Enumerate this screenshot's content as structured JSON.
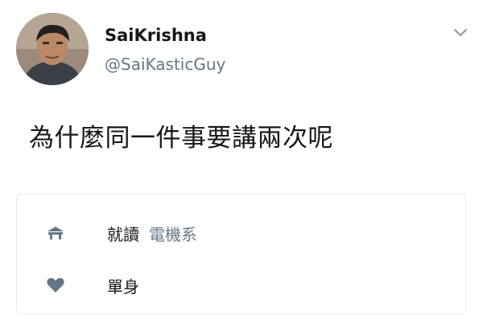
{
  "user": {
    "display_name": "SaiKrishna",
    "handle": "@SaiKasticGuy"
  },
  "tweet": {
    "text": "為什麼同一件事要講兩次呢"
  },
  "card": {
    "rows": [
      {
        "icon": "building-icon",
        "label": "就讀",
        "sublabel": "電機系"
      },
      {
        "icon": "heart-icon",
        "label": "單身",
        "sublabel": ""
      }
    ]
  },
  "colors": {
    "text_primary": "#14171a",
    "text_secondary": "#657786",
    "icon": "#657786",
    "border": "#e6ecf0"
  }
}
